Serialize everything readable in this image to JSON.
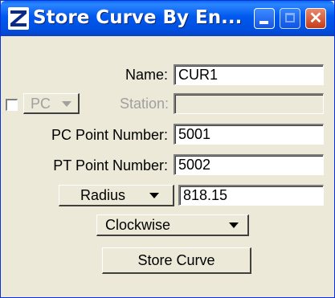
{
  "window": {
    "title": "Store Curve By En..."
  },
  "name_row": {
    "label": "Name:",
    "value": "CUR1"
  },
  "station_row": {
    "checked": false,
    "type_value": "PC",
    "label": "Station:",
    "value": ""
  },
  "pc_row": {
    "label": "PC Point Number:",
    "value": "5001"
  },
  "pt_row": {
    "label": "PT Point Number:",
    "value": "5002"
  },
  "radius_row": {
    "type_value": "Radius",
    "value": "818.15"
  },
  "direction": {
    "value": "Clockwise"
  },
  "store_button": {
    "label": "Store Curve"
  }
}
